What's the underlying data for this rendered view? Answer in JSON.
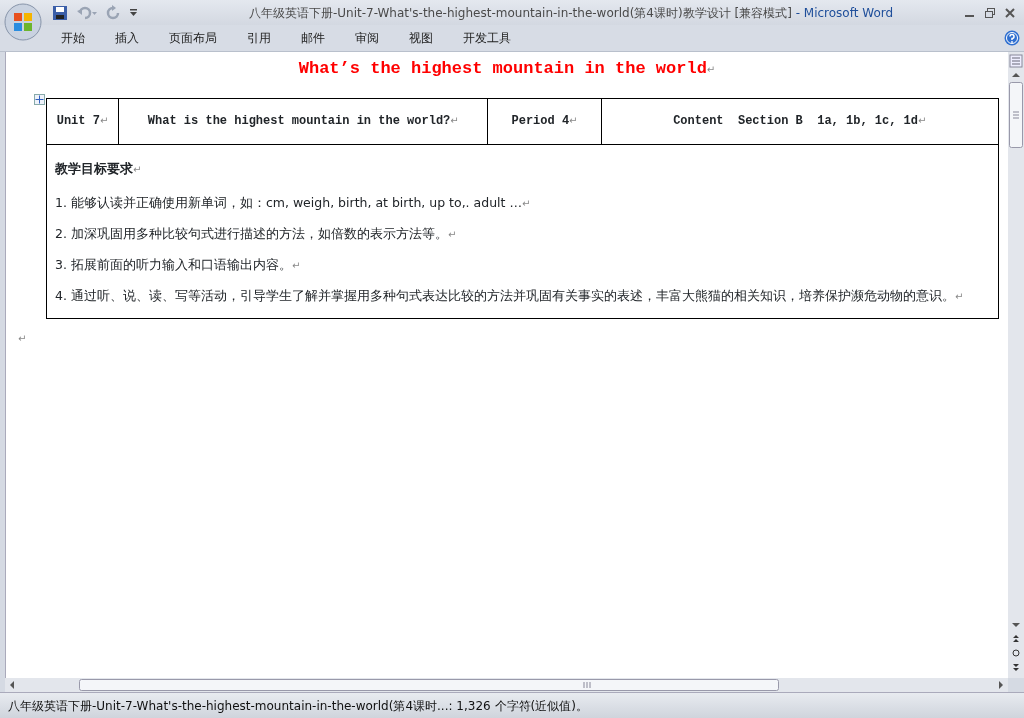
{
  "window": {
    "title": "八年级英语下册-Unit-7-What's-the-highest-mountain-in-the-world(第4课时)教学设计 [兼容模式]",
    "app_name": "- Microsoft Word"
  },
  "ribbon_tabs": [
    {
      "label": "开始",
      "selected": false
    },
    {
      "label": "插入",
      "selected": false
    },
    {
      "label": "页面布局",
      "selected": false
    },
    {
      "label": "引用",
      "selected": false
    },
    {
      "label": "邮件",
      "selected": false
    },
    {
      "label": "审阅",
      "selected": false
    },
    {
      "label": "视图",
      "selected": false
    },
    {
      "label": "开发工具",
      "selected": false
    }
  ],
  "document": {
    "heading": "What’s the highest mountain in the world",
    "paragraph_mark": "↵",
    "header_row": [
      "Unit 7",
      "What is the highest mountain in the world?",
      "Period 4",
      "Content  Section B  1a, 1b, 1c, 1d"
    ],
    "objectives_title": "教学目标要求",
    "objectives": [
      "1. 能够认读并正确使用新单词，如：cm, weigh, birth, at birth, up to,. adult …",
      "2. 加深巩固用多种比较句式进行描述的方法，如倍数的表示方法等。",
      "3. 拓展前面的听力输入和口语输出内容。",
      "4. 通过听、说、读、写等活动，引导学生了解并掌握用多种句式表达比较的方法并巩固有关事实的表述，丰富大熊猫的相关知识，培养保护濒危动物的意识。"
    ]
  },
  "status_bar": {
    "text": "八年级英语下册-Unit-7-What's-the-highest-mountain-in-the-world(第4课时...: 1,326 个字符(近似值)。"
  }
}
